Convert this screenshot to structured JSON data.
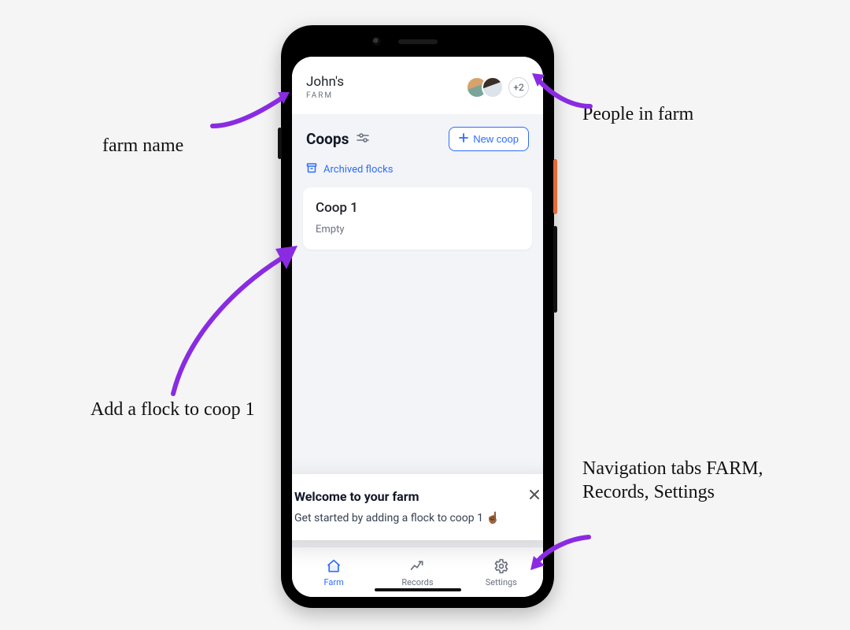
{
  "header": {
    "farm_name": "John's",
    "farm_sub": "FARM",
    "more_count": "+2"
  },
  "section": {
    "title": "Coops",
    "new_button": "New coop",
    "archived_label": "Archived flocks"
  },
  "coops": [
    {
      "name": "Coop 1",
      "status": "Empty"
    }
  ],
  "toast": {
    "title": "Welcome to your farm",
    "body": "Get started by adding a flock to coop 1 ☝🏾"
  },
  "nav": {
    "items": [
      {
        "label": "Farm",
        "active": true
      },
      {
        "label": "Records",
        "active": false
      },
      {
        "label": "Settings",
        "active": false
      }
    ]
  },
  "annotations": {
    "farm_name": "farm name",
    "people": "People in farm",
    "add_flock": "Add a flock to coop 1",
    "nav_tabs": "Navigation tabs FARM, Records, Settings"
  },
  "colors": {
    "accent_blue": "#2e6bff",
    "annotation_purple": "#8a2be2"
  }
}
